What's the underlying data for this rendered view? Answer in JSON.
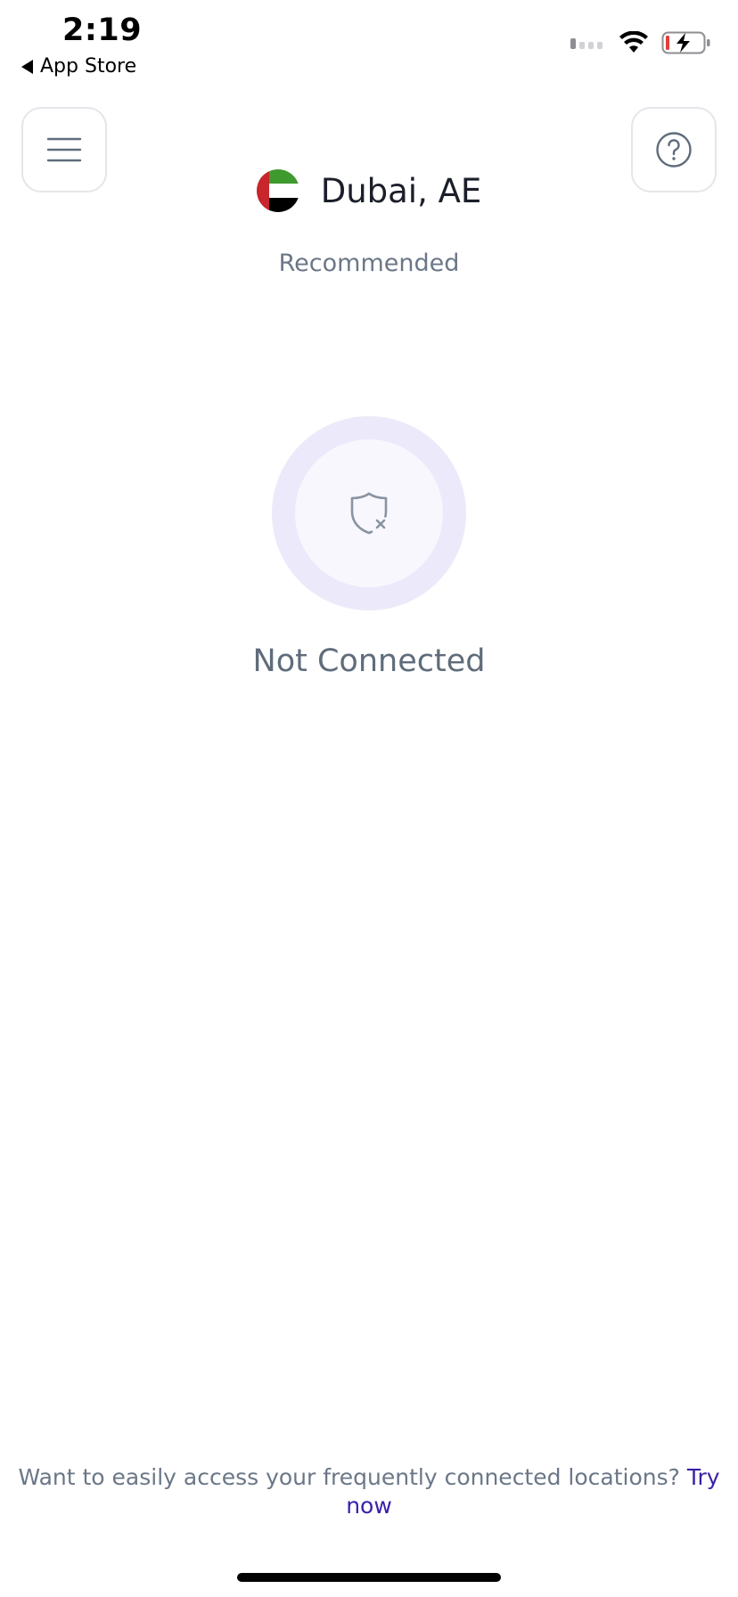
{
  "status_bar": {
    "time": "2:19",
    "back_label": "App Store",
    "icons": [
      "signal-icon",
      "wifi-icon",
      "battery-charging-icon"
    ]
  },
  "header": {
    "menu_icon": "hamburger-menu-icon",
    "help_icon": "question-circle-icon"
  },
  "location": {
    "name": "Dubai, AE",
    "flag": "uae-flag-icon",
    "subtitle": "Recommended"
  },
  "connection": {
    "icon": "shield-x-icon",
    "status": "Not Connected"
  },
  "promo": {
    "text": "Want to easily access your frequently connected locations?",
    "link_label": "Try now"
  },
  "colors": {
    "accent": "#3a1fa8",
    "ring_outer": "#eceafa",
    "ring_inner": "#f8f7fe",
    "muted_text": "#6b7787",
    "battery_low": "#e0403a"
  }
}
